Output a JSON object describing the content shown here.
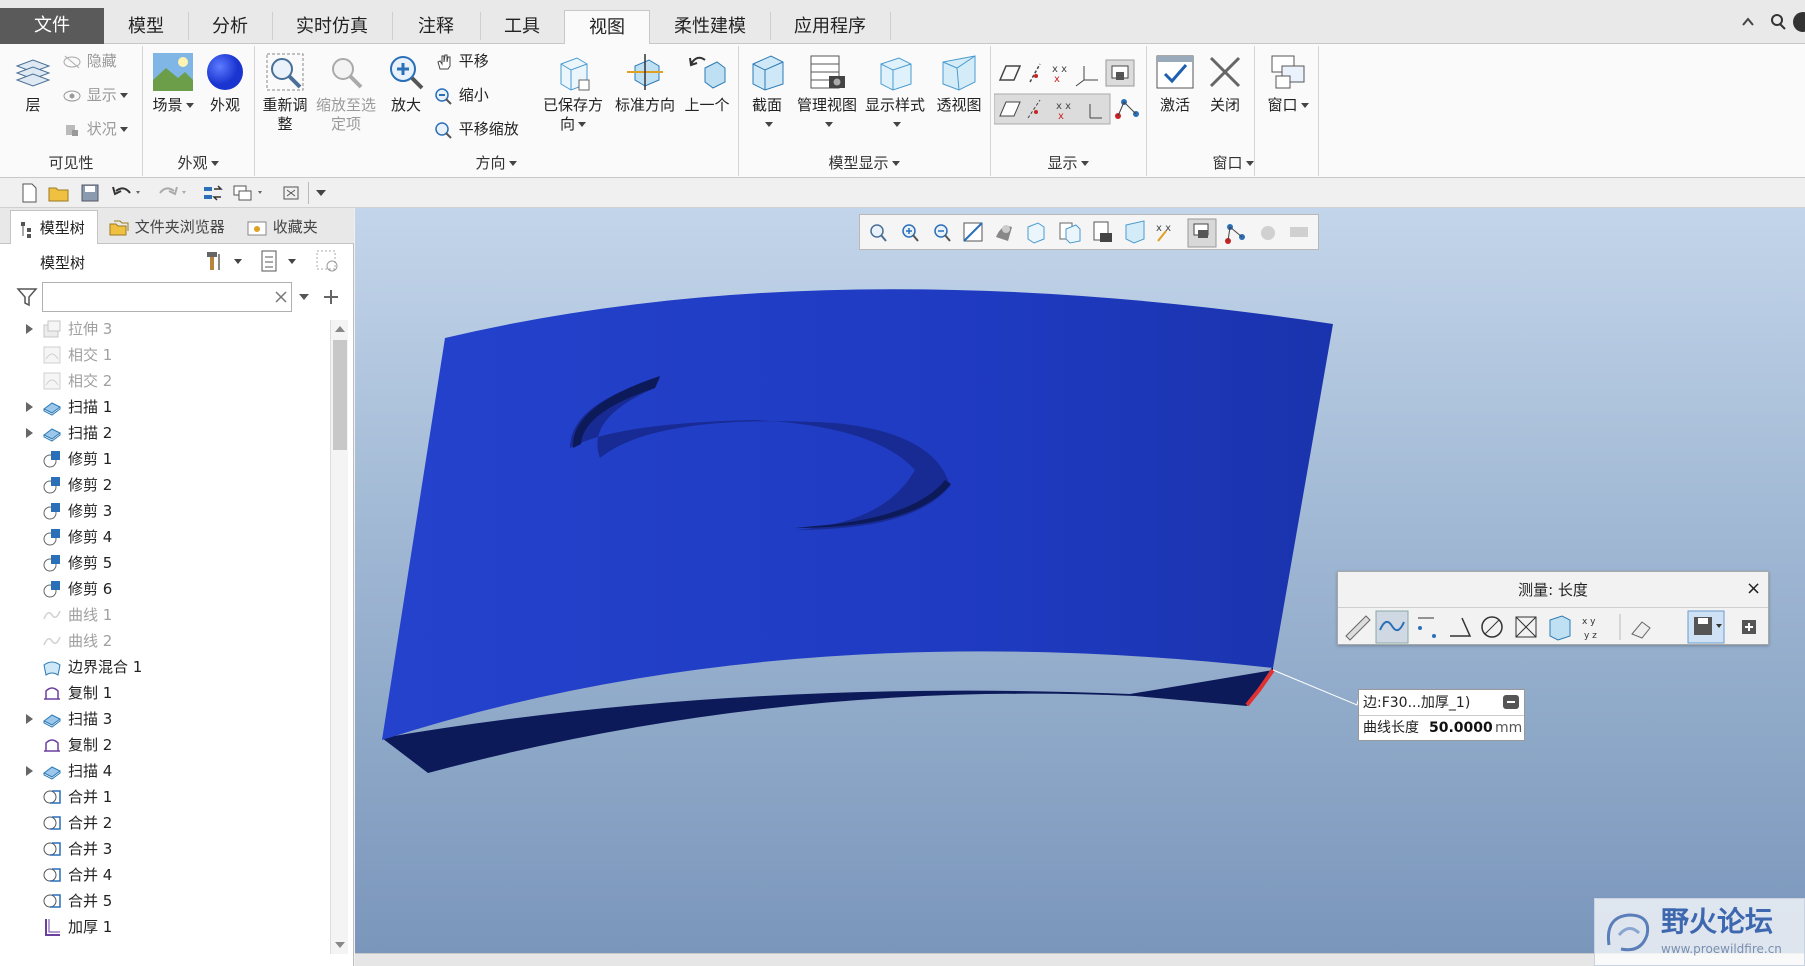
{
  "tabs": [
    "文件",
    "模型",
    "分析",
    "实时仿真",
    "注释",
    "工具",
    "视图",
    "柔性建模",
    "应用程序"
  ],
  "active_tab": "视图",
  "ribbon": {
    "visibility": {
      "layer": "层",
      "hide": "隐藏",
      "show": "显示",
      "status": "状况",
      "label": "可见性"
    },
    "appearance": {
      "scene": "场景",
      "appearance": "外观",
      "label": "外观"
    },
    "orientation": {
      "refit": "重新调整",
      "zoom_to_selected": "缩放至选定项",
      "zoom_in": "放大",
      "pan": "平移",
      "zoom_out": "缩小",
      "pan_zoom": "平移缩放",
      "saved_orientations": "已保存方向",
      "standard_orientation": "标准方向",
      "previous": "上一个",
      "label": "方向"
    },
    "model_display": {
      "section": "截面",
      "manage_views": "管理视图",
      "display_style": "显示样式",
      "perspective": "透视图",
      "label": "模型显示"
    },
    "show": {
      "label": "显示"
    },
    "window": {
      "activate": "激活",
      "close": "关闭",
      "window": "窗口",
      "label": "窗口"
    }
  },
  "left_panel": {
    "tabs": [
      "模型树",
      "文件夹浏览器",
      "收藏夹"
    ],
    "header": "模型树",
    "search_placeholder": "",
    "tree_items": [
      {
        "label": "拉伸 3",
        "icon": "extrude-icon",
        "expandable": true,
        "dim": true
      },
      {
        "label": "相交 1",
        "icon": "intersect-icon",
        "expandable": false,
        "dim": true
      },
      {
        "label": "相交 2",
        "icon": "intersect-icon",
        "expandable": false,
        "dim": true
      },
      {
        "label": "扫描 1",
        "icon": "sweep-icon",
        "expandable": true,
        "dim": false
      },
      {
        "label": "扫描 2",
        "icon": "sweep-icon",
        "expandable": true,
        "dim": false
      },
      {
        "label": "修剪 1",
        "icon": "trim-icon",
        "expandable": false,
        "dim": false
      },
      {
        "label": "修剪 2",
        "icon": "trim-icon",
        "expandable": false,
        "dim": false
      },
      {
        "label": "修剪 3",
        "icon": "trim-icon",
        "expandable": false,
        "dim": false
      },
      {
        "label": "修剪 4",
        "icon": "trim-icon",
        "expandable": false,
        "dim": false
      },
      {
        "label": "修剪 5",
        "icon": "trim-icon",
        "expandable": false,
        "dim": false
      },
      {
        "label": "修剪 6",
        "icon": "trim-icon",
        "expandable": false,
        "dim": false
      },
      {
        "label": "曲线 1",
        "icon": "curve-icon",
        "expandable": false,
        "dim": true
      },
      {
        "label": "曲线 2",
        "icon": "curve-icon",
        "expandable": false,
        "dim": true
      },
      {
        "label": "边界混合 1",
        "icon": "boundary-blend-icon",
        "expandable": false,
        "dim": false
      },
      {
        "label": "复制 1",
        "icon": "copy-icon",
        "expandable": false,
        "dim": false
      },
      {
        "label": "扫描 3",
        "icon": "sweep-icon",
        "expandable": true,
        "dim": false
      },
      {
        "label": "复制 2",
        "icon": "copy-icon",
        "expandable": false,
        "dim": false
      },
      {
        "label": "扫描 4",
        "icon": "sweep-icon",
        "expandable": true,
        "dim": false
      },
      {
        "label": "合并 1",
        "icon": "merge-icon",
        "expandable": false,
        "dim": false
      },
      {
        "label": "合并 2",
        "icon": "merge-icon",
        "expandable": false,
        "dim": false
      },
      {
        "label": "合并 3",
        "icon": "merge-icon",
        "expandable": false,
        "dim": false
      },
      {
        "label": "合并 4",
        "icon": "merge-icon",
        "expandable": false,
        "dim": false
      },
      {
        "label": "合并 5",
        "icon": "merge-icon",
        "expandable": false,
        "dim": false
      },
      {
        "label": "加厚 1",
        "icon": "thicken-icon",
        "expandable": false,
        "dim": false
      }
    ]
  },
  "measure": {
    "title": "测量: 长度",
    "close": "×",
    "callout_ref": "边:F30...加厚_1)",
    "callout_label": "曲线长度",
    "callout_value": "50.0000",
    "callout_unit": "mm"
  },
  "watermark": {
    "title": "野火论坛",
    "url": "www.proewildfire.cn"
  },
  "colors": {
    "model": "#2038c4",
    "model_side": "#0d1a5a",
    "viewport_top": "#c3d5ea",
    "viewport_bottom": "#7a96bb",
    "highlight": "#e03030"
  }
}
